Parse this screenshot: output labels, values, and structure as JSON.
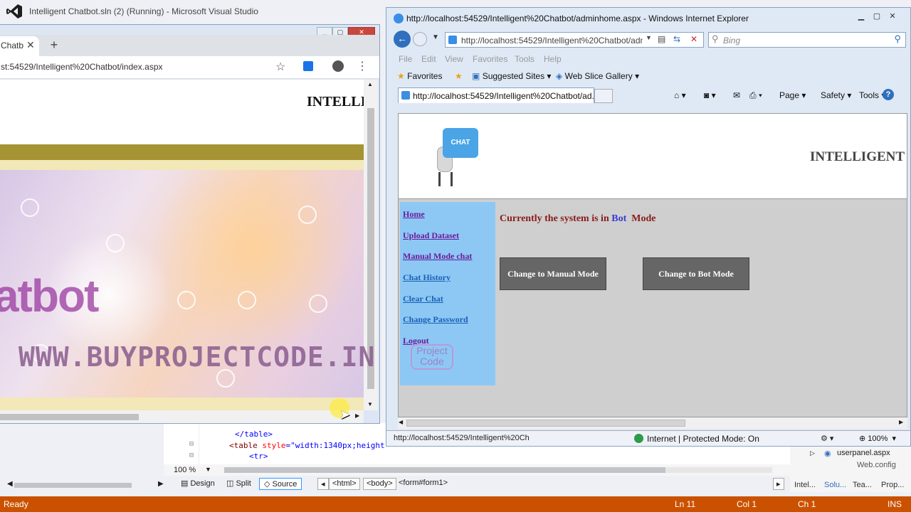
{
  "vs": {
    "title": "Intelligent Chatbot.sln (2) (Running) - Microsoft Visual Studio",
    "code_lines": [
      {
        "tag": "</table>"
      },
      {
        "tag": "<table",
        "attr": " style",
        "val": "=\"width:1340px;height"
      },
      {
        "tag": "<tr>"
      }
    ],
    "zoom": "100 %",
    "views": {
      "design": "Design",
      "split": "Split",
      "source": "Source"
    },
    "breadcrumbs": [
      "<html>",
      "<body>",
      "<form#form1>"
    ],
    "solution": {
      "item1": "userpanel.aspx",
      "item2": "Web.config"
    },
    "panel_tabs": [
      "Intel...",
      "Solu...",
      "Tea...",
      "Prop..."
    ],
    "status": {
      "ready": "Ready",
      "ln": "Ln 11",
      "col": "Col 1",
      "ch": "Ch 1",
      "ins": "INS"
    }
  },
  "chrome": {
    "tab_label": "Chatb",
    "url": "st:54529/Intelligent%20Chatbot/index.aspx",
    "heading": "INTELLI",
    "hero_text": "atbot"
  },
  "watermark": {
    "text": "WWW.BUYPROJECTCODE.IN",
    "logo_line1": "Project",
    "logo_line2": "Code"
  },
  "ie": {
    "title": "http://localhost:54529/Intelligent%20Chatbot/adminhome.aspx - Windows Internet Explorer",
    "address": "http://localhost:54529/Intelligent%20Chatbot/adm",
    "search_placeholder": "Bing",
    "menu": [
      "File",
      "Edit",
      "View",
      "Favorites",
      "Tools",
      "Help"
    ],
    "favorites_label": "Favorites",
    "suggested_sites": "Suggested Sites",
    "web_slice_gallery": "Web Slice Gallery",
    "tab_title": "http://localhost:54529/Intelligent%20Chatbot/ad...",
    "commands": {
      "page": "Page",
      "safety": "Safety",
      "tools": "Tools"
    },
    "status_url": "http://localhost:54529/Intelligent%20Ch",
    "zone": "Internet | Protected Mode: On",
    "zoom": "100%"
  },
  "site": {
    "logo_text": "CHAT BOT",
    "title": "INTELLIGENT",
    "nav": [
      {
        "label": "Home",
        "visited": true
      },
      {
        "label": "Upload Dataset",
        "visited": true
      },
      {
        "label": "Manual Mode chat",
        "visited": true
      },
      {
        "label": "Chat History",
        "visited": false
      },
      {
        "label": "Clear Chat",
        "visited": false
      },
      {
        "label": "Change Password",
        "visited": false
      },
      {
        "label": "Logout",
        "visited": true
      }
    ],
    "mode_prefix": "Currently the system is in",
    "mode_value": "Bot",
    "mode_suffix": "Mode",
    "btn_manual": "Change to Manual Mode",
    "btn_bot": "Change to Bot Mode"
  }
}
